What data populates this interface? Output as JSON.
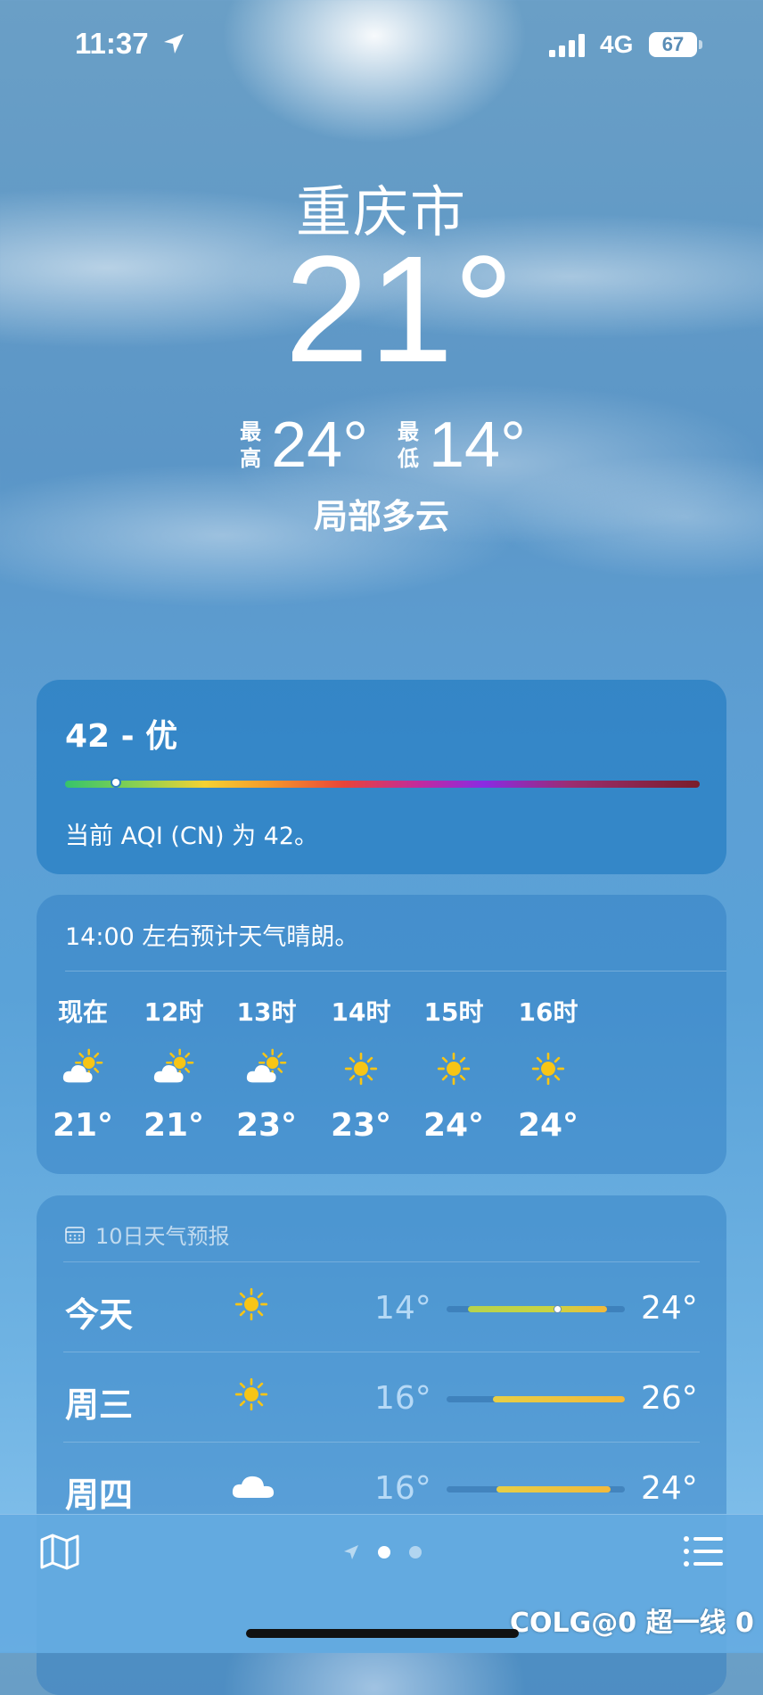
{
  "status_bar": {
    "time": "11:37",
    "network": "4G",
    "battery": "67"
  },
  "location": {
    "city": "重庆市",
    "temperature": "21°",
    "high_label": "最高",
    "high": "24°",
    "low_label": "最低",
    "low": "14°",
    "condition": "局部多云"
  },
  "aqi": {
    "value_label": "42 - 优",
    "description": "当前 AQI (CN) 为 42。",
    "level_fraction": 0.08
  },
  "hourly": {
    "summary": "14:00 左右预计天气晴朗。",
    "items": [
      {
        "label": "现在",
        "icon": "partly-sunny-icon",
        "temp": "21°"
      },
      {
        "label": "12时",
        "icon": "partly-sunny-icon",
        "temp": "21°"
      },
      {
        "label": "13时",
        "icon": "partly-sunny-icon",
        "temp": "23°"
      },
      {
        "label": "14时",
        "icon": "sun-icon",
        "temp": "23°"
      },
      {
        "label": "15时",
        "icon": "sun-icon",
        "temp": "24°"
      },
      {
        "label": "16时",
        "icon": "sun-icon",
        "temp": "24°"
      }
    ]
  },
  "daily": {
    "header": "10日天气预报",
    "days": [
      {
        "name": "今天",
        "icon": "sun-icon",
        "low": "14°",
        "high": "24°",
        "range_start": 0.12,
        "range_end": 0.9,
        "current": 0.62
      },
      {
        "name": "周三",
        "icon": "sun-icon",
        "low": "16°",
        "high": "26°",
        "range_start": 0.26,
        "range_end": 1.0,
        "current": null
      },
      {
        "name": "周四",
        "icon": "cloud-icon",
        "low": "16°",
        "high": "24°",
        "range_start": 0.28,
        "range_end": 0.92,
        "current": null
      }
    ]
  },
  "watermark": "COLG@0 超一线 0",
  "colors": {
    "sun": "#f7c516",
    "aqi_good": "#36c46b",
    "bar_warm": "#f2b93b"
  }
}
